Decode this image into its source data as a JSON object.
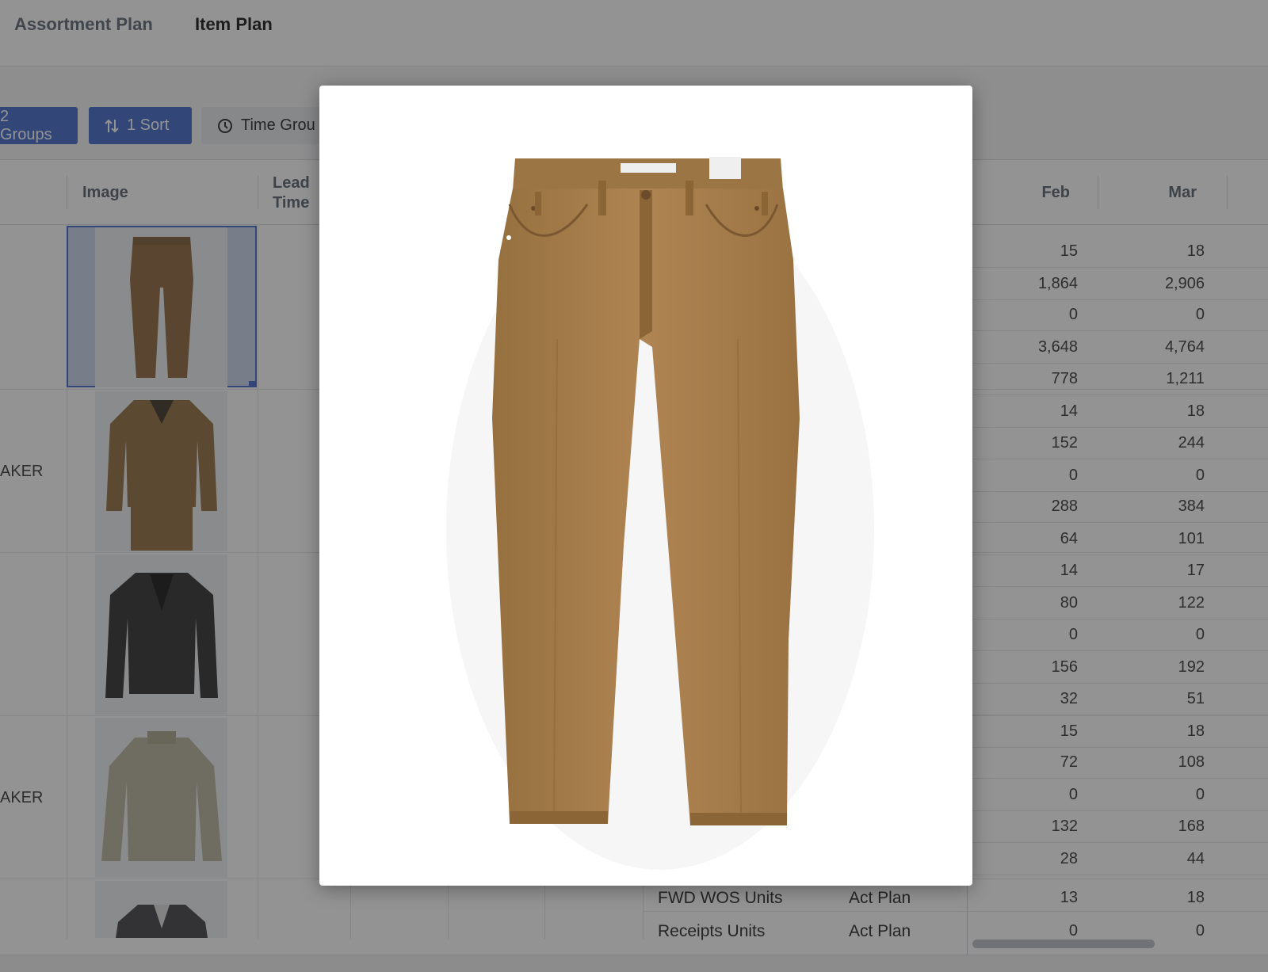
{
  "tabs": {
    "assortment_plan": "Assortment Plan",
    "item_plan": "Item Plan"
  },
  "toolbar": {
    "groups_label": "2 Groups",
    "sort_label": "1 Sort",
    "time_group_label": "Time Grou"
  },
  "columns": {
    "image": "Image",
    "lead_time_line1": "Lead",
    "lead_time_line2": "Time",
    "feb": "Feb",
    "mar": "Mar"
  },
  "row_labels": [
    "AKER",
    "AKER"
  ],
  "metric_rows": [
    {
      "feb": "15",
      "mar": "18"
    },
    {
      "feb": "1,864",
      "mar": "2,906"
    },
    {
      "feb": "0",
      "mar": "0"
    },
    {
      "feb": "3,648",
      "mar": "4,764"
    },
    {
      "feb": "778",
      "mar": "1,211"
    },
    {
      "feb": "14",
      "mar": "18"
    },
    {
      "feb": "152",
      "mar": "244"
    },
    {
      "feb": "0",
      "mar": "0"
    },
    {
      "feb": "288",
      "mar": "384"
    },
    {
      "feb": "64",
      "mar": "101"
    },
    {
      "feb": "14",
      "mar": "17"
    },
    {
      "feb": "80",
      "mar": "122"
    },
    {
      "feb": "0",
      "mar": "0"
    },
    {
      "feb": "156",
      "mar": "192"
    },
    {
      "feb": "32",
      "mar": "51"
    },
    {
      "feb": "15",
      "mar": "18"
    },
    {
      "feb": "72",
      "mar": "108"
    },
    {
      "feb": "0",
      "mar": "0"
    },
    {
      "feb": "132",
      "mar": "168"
    },
    {
      "feb": "28",
      "mar": "44"
    },
    {
      "feb": "13",
      "mar": "18"
    },
    {
      "feb": "0",
      "mar": "0"
    }
  ],
  "bottom_rows": [
    {
      "label": "FWD WOS Units",
      "type": "Act Plan"
    },
    {
      "label": "Receipts Units",
      "type": "Act Plan"
    }
  ],
  "product_images": [
    "tan-pants",
    "tan-denim-jacket",
    "black-leather-jacket",
    "beige-jacket",
    "grey-blazer"
  ],
  "colors": {
    "accent": "#3d64c8",
    "overlay": "rgba(40,40,40,0.5)",
    "pants": "#a57a48"
  },
  "modal": {
    "image": "tan-pants-large"
  }
}
